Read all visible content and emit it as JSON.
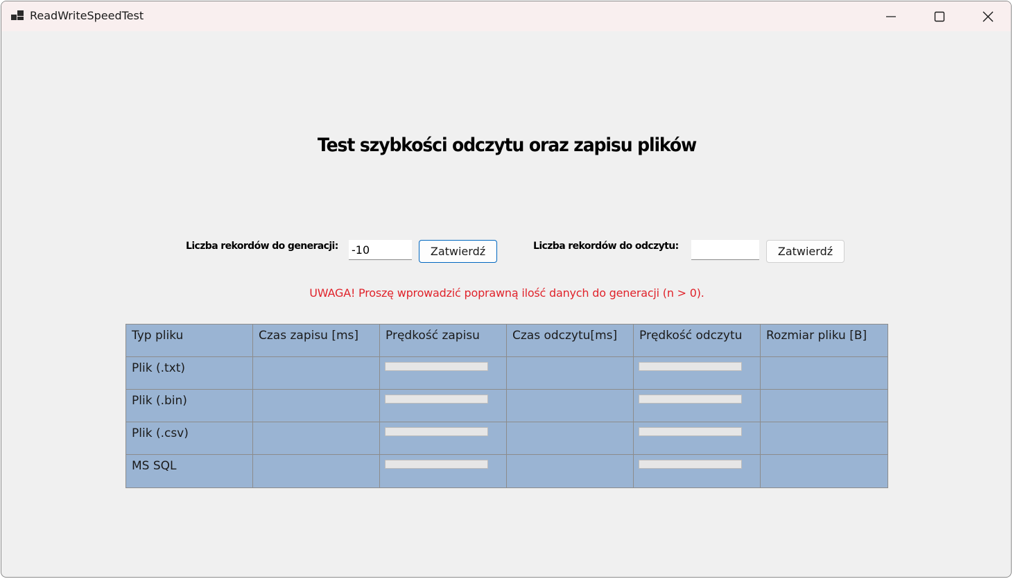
{
  "window": {
    "title": "ReadWriteSpeedTest"
  },
  "heading": "Test szybkości odczytu oraz zapisu plików",
  "generate": {
    "label": "Liczba rekordów do generacji:",
    "value": "-10",
    "button": "Zatwierdź"
  },
  "read": {
    "label": "Liczba rekordów do odczytu:",
    "value": "",
    "button": "Zatwierdź"
  },
  "warning": "UWAGA! Proszę wprowadzić poprawną ilość danych do generacji (n > 0).",
  "colors": {
    "warning": "#e0232b",
    "grid_background": "#9ab4d3",
    "focus_border": "#0067c0"
  },
  "table": {
    "headers": [
      "Typ pliku",
      "Czas zapisu [ms]",
      "Prędkość zapisu",
      "Czas odczytu[ms]",
      "Prędkość odczytu",
      "Rozmiar pliku [B]"
    ],
    "rows": [
      {
        "type": "Plik (.txt)",
        "write_time": "",
        "write_progress": 0,
        "read_time": "",
        "read_progress": 0,
        "size": ""
      },
      {
        "type": "Plik (.bin)",
        "write_time": "",
        "write_progress": 0,
        "read_time": "",
        "read_progress": 0,
        "size": ""
      },
      {
        "type": "Plik (.csv)",
        "write_time": "",
        "write_progress": 0,
        "read_time": "",
        "read_progress": 0,
        "size": ""
      },
      {
        "type": "MS SQL",
        "write_time": "",
        "write_progress": 0,
        "read_time": "",
        "read_progress": 0,
        "size": ""
      }
    ]
  }
}
